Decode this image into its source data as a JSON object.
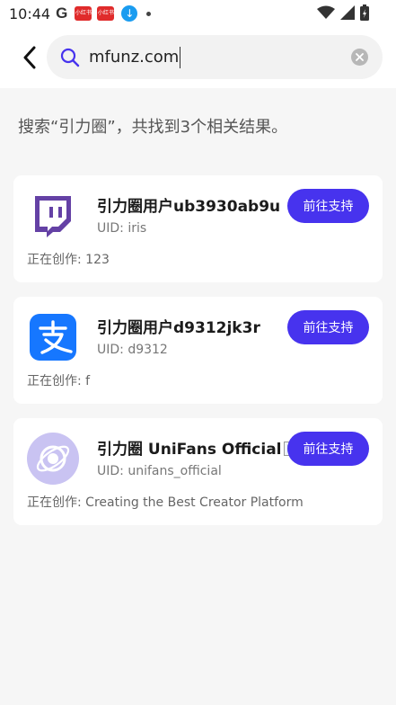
{
  "status_bar": {
    "time": "10:44",
    "google_letter": "G",
    "notif_app_1": "小红书",
    "notif_app_2": "小红书",
    "download_glyph": "↓"
  },
  "search": {
    "value": "mfunz.com"
  },
  "results_summary": "搜索“引力圈”，共找到3个相关结果。",
  "results": [
    {
      "name": "引力圈用户ub3930ab9u",
      "uid": "UID: iris",
      "creating": "正在创作: 123",
      "button": "前往支持",
      "avatar_icon": "twitch-icon"
    },
    {
      "name": "引力圈用户d9312jk3r",
      "uid": "UID: d9312",
      "creating": "正在创作: f",
      "button": "前往支持",
      "avatar_icon": "alipay-icon"
    },
    {
      "name": "引力圈 UniFans Official",
      "uid": "UID: unifans_official",
      "creating": "正在创作: Creating the Best Creator Platform",
      "button": "前往支持",
      "avatar_icon": "unifans-logo-icon"
    }
  ],
  "colors": {
    "accent": "#4733ee",
    "twitch": "#6441a5",
    "alipay": "#1677ff",
    "unifans": "#c9c3f2"
  }
}
